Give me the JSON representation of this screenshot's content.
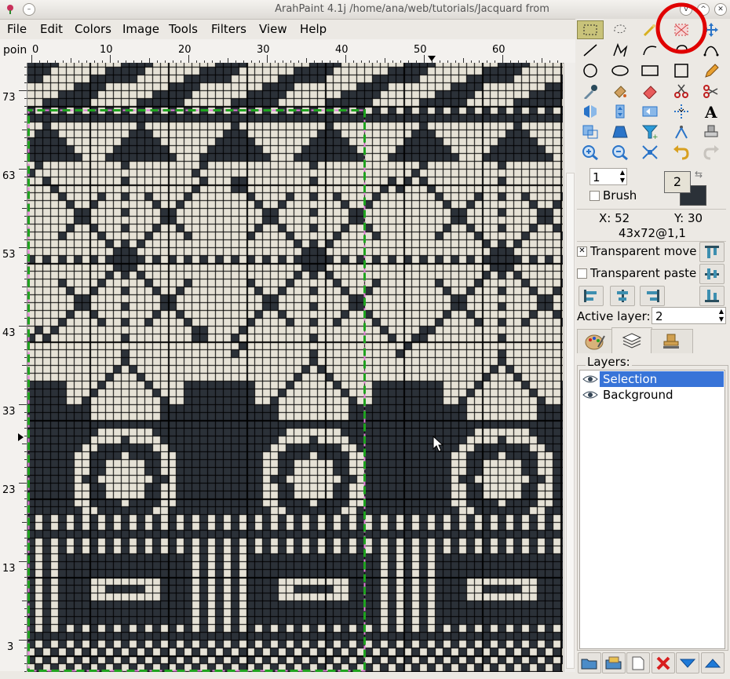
{
  "window": {
    "title": "ArahPaint 4.1j /home/ana/web/tutorials/Jacquard from",
    "buttons": [
      "minimize",
      "maximize",
      "close"
    ]
  },
  "menu": [
    "File",
    "Edit",
    "Colors",
    "Image",
    "Tools",
    "Filters",
    "View",
    "Help"
  ],
  "ruler": {
    "corner_label": "poin",
    "top_labels": [
      "0",
      "10",
      "20",
      "30",
      "40",
      "50",
      "60"
    ],
    "left_labels": [
      "73",
      "63",
      "53",
      "43",
      "33",
      "23",
      "13",
      "3"
    ]
  },
  "toolbox": {
    "tools": [
      "rectangle-select-icon",
      "lasso-select-icon",
      "magic-wand-icon",
      "deselect-icon",
      "move-icon",
      "line-icon",
      "polyline-icon",
      "curve-icon",
      "rotate-icon",
      "bezier-icon",
      "circle-icon",
      "ellipse-icon",
      "rectangle-icon",
      "square-icon",
      "pencil-icon",
      "color-picker-icon",
      "fill-icon",
      "eraser-icon",
      "cut-icon",
      "scissors-icon",
      "flip-icon",
      "flip-vertical-icon",
      "mirror-icon",
      "center-icon",
      "text-icon",
      "resize-icon",
      "perspective-icon",
      "filter-icon",
      "compass-icon",
      "stamp-icon",
      "zoom-in-icon",
      "zoom-out-icon",
      "fit-icon",
      "undo-icon",
      "redo-icon"
    ]
  },
  "brush": {
    "size_value": "1",
    "brush_label": "Brush",
    "color_number": "2",
    "fg_color": "#2b3138",
    "bg_color": "#e6e2d6"
  },
  "status": {
    "x_label": "X: 52",
    "y_label": "Y: 30",
    "size_info": "43x72@1,1"
  },
  "options": {
    "transparent_move": "Transparent move",
    "transparent_move_checked": true,
    "transparent_paste": "Transparent paste",
    "transparent_paste_checked": false
  },
  "active_layer": {
    "label": "Active layer:",
    "value": "2"
  },
  "layers": {
    "title": "Layers:",
    "items": [
      {
        "name": "Selection",
        "selected": true
      },
      {
        "name": "Background",
        "selected": false
      }
    ]
  },
  "colors": {
    "dark": "#2b3138",
    "light": "#e6e2d6",
    "selection_green": "#1fa31f",
    "selection_pink": "#e27ad8",
    "highlight": "#3874d8",
    "annotation_red": "#e00000"
  }
}
